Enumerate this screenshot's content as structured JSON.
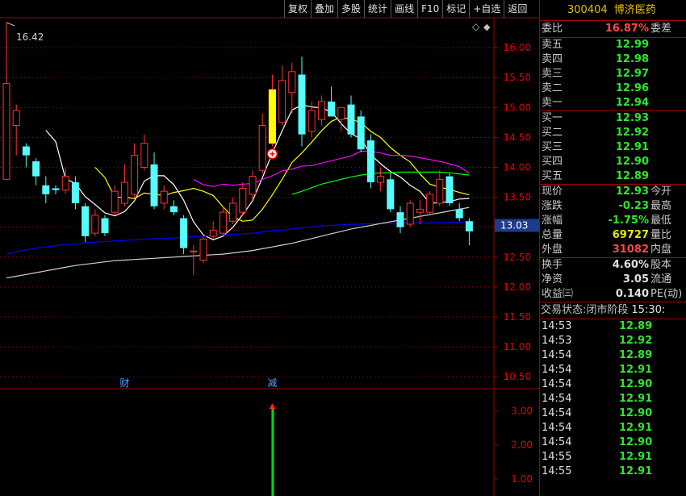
{
  "toolbar": {
    "items": [
      "复权",
      "叠加",
      "多股",
      "统计",
      "画线",
      "F10",
      "标记",
      "+自选",
      "返回"
    ]
  },
  "stock": {
    "code": "300404",
    "name": "博济医药"
  },
  "quote": {
    "weibi": {
      "label": "委比",
      "value": "16.87%",
      "label2": "委差"
    },
    "sells": [
      {
        "label": "卖五",
        "price": "12.99"
      },
      {
        "label": "卖四",
        "price": "12.98"
      },
      {
        "label": "卖三",
        "price": "12.97"
      },
      {
        "label": "卖二",
        "price": "12.96"
      },
      {
        "label": "卖一",
        "price": "12.94"
      }
    ],
    "buys": [
      {
        "label": "买一",
        "price": "12.93"
      },
      {
        "label": "买二",
        "price": "12.92"
      },
      {
        "label": "买三",
        "price": "12.91"
      },
      {
        "label": "买四",
        "price": "12.90"
      },
      {
        "label": "买五",
        "price": "12.89"
      }
    ],
    "stats1": [
      {
        "label": "现价",
        "value": "12.93",
        "label2": "今开",
        "color": "green"
      },
      {
        "label": "涨跌",
        "value": "-0.23",
        "label2": "最高",
        "color": "green"
      },
      {
        "label": "涨幅",
        "value": "-1.75%",
        "label2": "最低",
        "color": "green"
      },
      {
        "label": "总量",
        "value": "69727",
        "label2": "量比",
        "color": "yellow"
      },
      {
        "label": "外盘",
        "value": "31082",
        "label2": "内盘",
        "color": "red"
      }
    ],
    "stats2": [
      {
        "label": "换手",
        "value": "4.60%",
        "label2": "股本",
        "color": "white"
      },
      {
        "label": "净资",
        "value": "3.05",
        "label2": "流通",
        "color": "white"
      },
      {
        "label": "收益㈢",
        "value": "0.140",
        "label2": "PE(动)",
        "color": "white"
      }
    ]
  },
  "status": {
    "label": "交易状态:",
    "value": "闭市阶段",
    "time": "15:30:"
  },
  "trades": [
    {
      "time": "14:53",
      "price": "12.89"
    },
    {
      "time": "14:53",
      "price": "12.92"
    },
    {
      "time": "14:54",
      "price": "12.89"
    },
    {
      "time": "14:54",
      "price": "12.91"
    },
    {
      "time": "14:54",
      "price": "12.90"
    },
    {
      "time": "14:54",
      "price": "12.91"
    },
    {
      "time": "14:54",
      "price": "12.90"
    },
    {
      "time": "14:54",
      "price": "12.91"
    },
    {
      "time": "14:54",
      "price": "12.90"
    },
    {
      "time": "14:55",
      "price": "12.91"
    },
    {
      "time": "14:55",
      "price": "12.91"
    }
  ],
  "colors": {
    "up": "#ff3232",
    "down": "#54fcfc",
    "ma5": "#ffffff",
    "ma10": "#ffff00",
    "ma20": "#ff00ff",
    "ma30": "#00ff00",
    "ma60": "#0000ff",
    "ma120": "#d0d0d0",
    "grid": "#a00000",
    "axis_text": "#e00000"
  },
  "chart_data": {
    "type": "candlestick",
    "price_axis": {
      "ylim": [
        10.3,
        16.5
      ],
      "ticks": [
        "16.00",
        "15.50",
        "15.00",
        "14.50",
        "14.00",
        "13.50",
        "13.00",
        "12.50",
        "12.00",
        "11.50",
        "11.00",
        "10.50"
      ]
    },
    "max_label": "16.42",
    "current_price_label": "13.03",
    "candles": [
      {
        "o": 13.8,
        "h": 16.42,
        "l": 13.8,
        "c": 15.4
      },
      {
        "o": 14.7,
        "h": 15.05,
        "l": 14.2,
        "c": 14.95
      },
      {
        "o": 14.35,
        "h": 14.4,
        "l": 14.0,
        "c": 14.2
      },
      {
        "o": 14.1,
        "h": 14.15,
        "l": 13.7,
        "c": 13.85
      },
      {
        "o": 13.7,
        "h": 13.85,
        "l": 13.4,
        "c": 13.55
      },
      {
        "o": 13.65,
        "h": 13.7,
        "l": 13.55,
        "c": 13.62
      },
      {
        "o": 13.62,
        "h": 14.0,
        "l": 13.55,
        "c": 13.85
      },
      {
        "o": 13.75,
        "h": 13.85,
        "l": 13.3,
        "c": 13.4
      },
      {
        "o": 13.35,
        "h": 13.4,
        "l": 12.75,
        "c": 12.85
      },
      {
        "o": 12.9,
        "h": 13.3,
        "l": 12.85,
        "c": 13.2
      },
      {
        "o": 13.15,
        "h": 13.2,
        "l": 12.85,
        "c": 12.9
      },
      {
        "o": 13.25,
        "h": 13.7,
        "l": 13.2,
        "c": 13.6
      },
      {
        "o": 13.4,
        "h": 14.05,
        "l": 13.35,
        "c": 13.75
      },
      {
        "o": 13.55,
        "h": 14.4,
        "l": 13.5,
        "c": 14.2
      },
      {
        "o": 14.0,
        "h": 14.55,
        "l": 13.95,
        "c": 14.4
      },
      {
        "o": 14.05,
        "h": 14.25,
        "l": 13.3,
        "c": 13.35
      },
      {
        "o": 13.4,
        "h": 13.7,
        "l": 13.3,
        "c": 13.6
      },
      {
        "o": 13.35,
        "h": 13.45,
        "l": 13.2,
        "c": 13.25
      },
      {
        "o": 13.15,
        "h": 13.2,
        "l": 12.55,
        "c": 12.65
      },
      {
        "o": 12.6,
        "h": 12.7,
        "l": 12.2,
        "c": 12.6
      },
      {
        "o": 12.45,
        "h": 12.85,
        "l": 12.4,
        "c": 12.8
      },
      {
        "o": 12.85,
        "h": 13.1,
        "l": 12.8,
        "c": 12.95
      },
      {
        "o": 12.9,
        "h": 13.35,
        "l": 12.85,
        "c": 13.25
      },
      {
        "o": 13.1,
        "h": 13.5,
        "l": 13.05,
        "c": 13.4
      },
      {
        "o": 13.25,
        "h": 13.75,
        "l": 13.2,
        "c": 13.65
      },
      {
        "o": 13.55,
        "h": 13.95,
        "l": 13.45,
        "c": 13.85
      },
      {
        "o": 13.95,
        "h": 14.9,
        "l": 13.9,
        "c": 14.7
      },
      {
        "o": 14.4,
        "h": 15.55,
        "l": 14.35,
        "c": 15.3
      },
      {
        "o": 14.75,
        "h": 15.7,
        "l": 14.7,
        "c": 15.45
      },
      {
        "o": 15.25,
        "h": 15.75,
        "l": 14.9,
        "c": 15.6
      },
      {
        "o": 15.55,
        "h": 15.85,
        "l": 14.35,
        "c": 14.55
      },
      {
        "o": 14.6,
        "h": 15.1,
        "l": 14.5,
        "c": 14.95
      },
      {
        "o": 14.8,
        "h": 15.2,
        "l": 14.7,
        "c": 15.1
      },
      {
        "o": 15.1,
        "h": 15.35,
        "l": 14.95,
        "c": 14.85
      },
      {
        "o": 14.8,
        "h": 15.0,
        "l": 14.6,
        "c": 15.0
      },
      {
        "o": 15.05,
        "h": 15.2,
        "l": 14.5,
        "c": 14.55
      },
      {
        "o": 14.85,
        "h": 14.95,
        "l": 14.25,
        "c": 14.3
      },
      {
        "o": 14.45,
        "h": 14.55,
        "l": 13.65,
        "c": 13.75
      },
      {
        "o": 13.75,
        "h": 14.0,
        "l": 13.6,
        "c": 13.85
      },
      {
        "o": 13.8,
        "h": 13.9,
        "l": 13.25,
        "c": 13.3
      },
      {
        "o": 13.25,
        "h": 13.35,
        "l": 12.9,
        "c": 13.0
      },
      {
        "o": 13.05,
        "h": 13.45,
        "l": 13.0,
        "c": 13.4
      },
      {
        "o": 13.25,
        "h": 13.45,
        "l": 13.05,
        "c": 13.3
      },
      {
        "o": 13.25,
        "h": 13.6,
        "l": 13.2,
        "c": 13.55
      },
      {
        "o": 13.4,
        "h": 13.95,
        "l": 13.35,
        "c": 13.8
      },
      {
        "o": 13.85,
        "h": 13.9,
        "l": 13.35,
        "c": 13.4
      },
      {
        "o": 13.3,
        "h": 13.4,
        "l": 13.1,
        "c": 13.15
      },
      {
        "o": 13.1,
        "h": 13.15,
        "l": 12.7,
        "c": 12.93
      }
    ],
    "series": [
      {
        "name": "MA5",
        "color": "#ffffff",
        "values": [
          null,
          null,
          null,
          null,
          14.62,
          14.43,
          13.81,
          13.73,
          13.51,
          13.38,
          13.24,
          13.19,
          13.26,
          13.44,
          13.77,
          13.86,
          13.86,
          13.71,
          13.45,
          13.09,
          12.87,
          12.79,
          12.85,
          13.0,
          13.21,
          13.44,
          13.83,
          14.24,
          14.61,
          14.96,
          15.04,
          15.01,
          14.99,
          14.93,
          14.73,
          14.56,
          14.48,
          14.21,
          14.06,
          13.93,
          13.84,
          13.7,
          13.6,
          13.4,
          13.41,
          13.43,
          13.47,
          13.48
        ]
      },
      {
        "name": "MA10",
        "color": "#ffff00",
        "values": [
          null,
          null,
          null,
          null,
          null,
          null,
          null,
          null,
          null,
          14.0,
          13.83,
          13.5,
          13.5,
          13.48,
          13.57,
          13.55,
          13.53,
          13.58,
          13.61,
          13.65,
          13.6,
          13.53,
          13.34,
          13.17,
          13.1,
          13.12,
          13.3,
          13.54,
          13.8,
          14.08,
          14.24,
          14.42,
          14.61,
          14.77,
          14.84,
          14.8,
          14.75,
          14.6,
          14.5,
          14.33,
          14.2,
          14.09,
          13.89,
          13.72,
          13.67,
          13.63,
          13.58,
          13.54
        ]
      },
      {
        "name": "MA20",
        "color": "#ff00ff",
        "values": [
          null,
          null,
          null,
          null,
          null,
          null,
          null,
          null,
          null,
          null,
          null,
          null,
          null,
          null,
          null,
          null,
          null,
          null,
          null,
          13.8,
          13.71,
          13.68,
          13.72,
          13.7,
          13.72,
          13.73,
          13.8,
          13.86,
          13.94,
          13.97,
          14.02,
          14.03,
          14.07,
          14.11,
          14.15,
          14.19,
          14.27,
          14.27,
          14.24,
          14.2,
          14.2,
          14.19,
          14.16,
          14.13,
          14.1,
          14.06,
          14.01,
          13.9
        ]
      },
      {
        "name": "MA30",
        "color": "#00ff00",
        "values": [
          null,
          null,
          null,
          null,
          null,
          null,
          null,
          null,
          null,
          null,
          null,
          null,
          null,
          null,
          null,
          null,
          null,
          null,
          null,
          null,
          null,
          null,
          null,
          null,
          null,
          null,
          null,
          null,
          null,
          13.55,
          13.6,
          13.66,
          13.72,
          13.76,
          13.8,
          13.84,
          13.87,
          13.89,
          13.91,
          13.91,
          13.92,
          13.92,
          13.92,
          13.92,
          13.92,
          13.91,
          13.89,
          13.87
        ]
      },
      {
        "name": "MA60",
        "color": "#0000ff",
        "values": [
          12.55,
          12.59,
          12.62,
          12.65,
          12.67,
          12.69,
          12.71,
          12.72,
          12.74,
          12.75,
          12.76,
          12.77,
          12.78,
          12.79,
          12.8,
          12.81,
          12.81,
          12.82,
          12.83,
          12.84,
          12.85,
          12.86,
          12.87,
          12.88,
          12.89,
          12.9,
          12.92,
          12.94,
          12.95,
          12.97,
          12.99,
          13.0,
          13.02,
          13.03,
          13.04,
          13.05,
          13.05,
          13.06,
          13.06,
          13.06,
          13.07,
          13.07,
          13.07,
          13.07,
          13.08,
          13.08,
          13.08,
          13.08
        ]
      },
      {
        "name": "MA120",
        "color": "#d0d0d0",
        "values": [
          12.15,
          12.18,
          12.21,
          12.24,
          12.27,
          12.3,
          12.33,
          12.36,
          12.38,
          12.4,
          12.42,
          12.44,
          12.45,
          12.46,
          12.47,
          12.48,
          12.49,
          12.5,
          12.51,
          12.52,
          12.53,
          12.54,
          12.55,
          12.57,
          12.59,
          12.61,
          12.64,
          12.67,
          12.7,
          12.73,
          12.77,
          12.81,
          12.85,
          12.89,
          12.93,
          12.97,
          13.0,
          13.03,
          13.06,
          13.09,
          13.12,
          13.15,
          13.18,
          13.21,
          13.24,
          13.27,
          13.3,
          13.33
        ]
      }
    ],
    "lower_panel": {
      "ylim": [
        0.5,
        3.6
      ],
      "ticks": [
        "3.00",
        "2.00",
        "1.00"
      ],
      "bars": [
        {
          "index": 27,
          "value": 3.1
        }
      ]
    },
    "events": [
      {
        "index": 12,
        "label": "财"
      },
      {
        "index": 27,
        "label": "减"
      }
    ],
    "marker_index": 27
  }
}
